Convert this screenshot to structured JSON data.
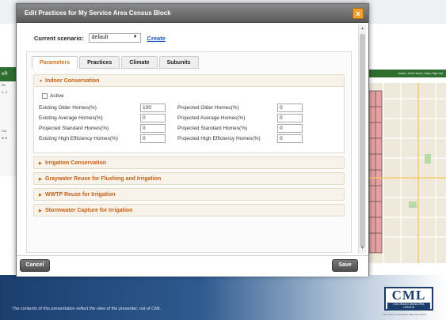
{
  "background": {
    "left_nav_label": "eR",
    "left_panel_lines": [
      "Re",
      "1. C",
      "Cur",
      "le N"
    ],
    "top_right_bar_text": "ecarlo | Cntrl Home | Help | Sign Out",
    "disclaimer": "The contents of this presentation reflect the view of the presenter, not of CML.",
    "logo": {
      "letters": "CML",
      "subtitle": "COLORADO MUNICIPAL LEAGUE",
      "tagline": "The Voice of Colorado's Cities and Towns"
    }
  },
  "dialog": {
    "title": "Edit Practices for My Service Area Census Block",
    "close_label": "x",
    "scenario": {
      "label": "Current scenario:",
      "selected": "default",
      "create_label": "Create"
    },
    "tabs": [
      {
        "label": "Parameters",
        "active": true
      },
      {
        "label": "Practices",
        "active": false
      },
      {
        "label": "Climate",
        "active": false
      },
      {
        "label": "Subunits",
        "active": false
      }
    ],
    "sections": {
      "indoor": {
        "title": "Indoor Conservation",
        "active_label": "Active",
        "left_fields": [
          {
            "label": "Existing Older Homes(%)",
            "value": "100"
          },
          {
            "label": "Existing Average Homes(%)",
            "value": "0"
          },
          {
            "label": "Projected Standard Homes(%)",
            "value": "0"
          },
          {
            "label": "Existing High Efficiency Homes(%)",
            "value": "0"
          }
        ],
        "right_fields": [
          {
            "label": "Projected Older Homes(%)",
            "value": "0"
          },
          {
            "label": "Projected Average Homes(%)",
            "value": "0"
          },
          {
            "label": "Projected Standard Homes(%)",
            "value": "0"
          },
          {
            "label": "Projected High Efficiency Homes(%)",
            "value": "0"
          }
        ]
      },
      "collapsed": [
        "Irrigation Conservation",
        "Graywater Reuse for Flushing and Irrigation",
        "WWTP Reuse for Irrigation",
        "Stormwater Capture for Irrigation"
      ]
    },
    "footer": {
      "cancel_label": "Cancel",
      "save_label": "Save"
    }
  },
  "colors": {
    "accent_orange": "#c65d12",
    "link_blue": "#1a55c4",
    "titlebar_gray": "#5a5a5a",
    "brand_green": "#2f6e2f",
    "cml_blue": "#1c3d6c"
  }
}
